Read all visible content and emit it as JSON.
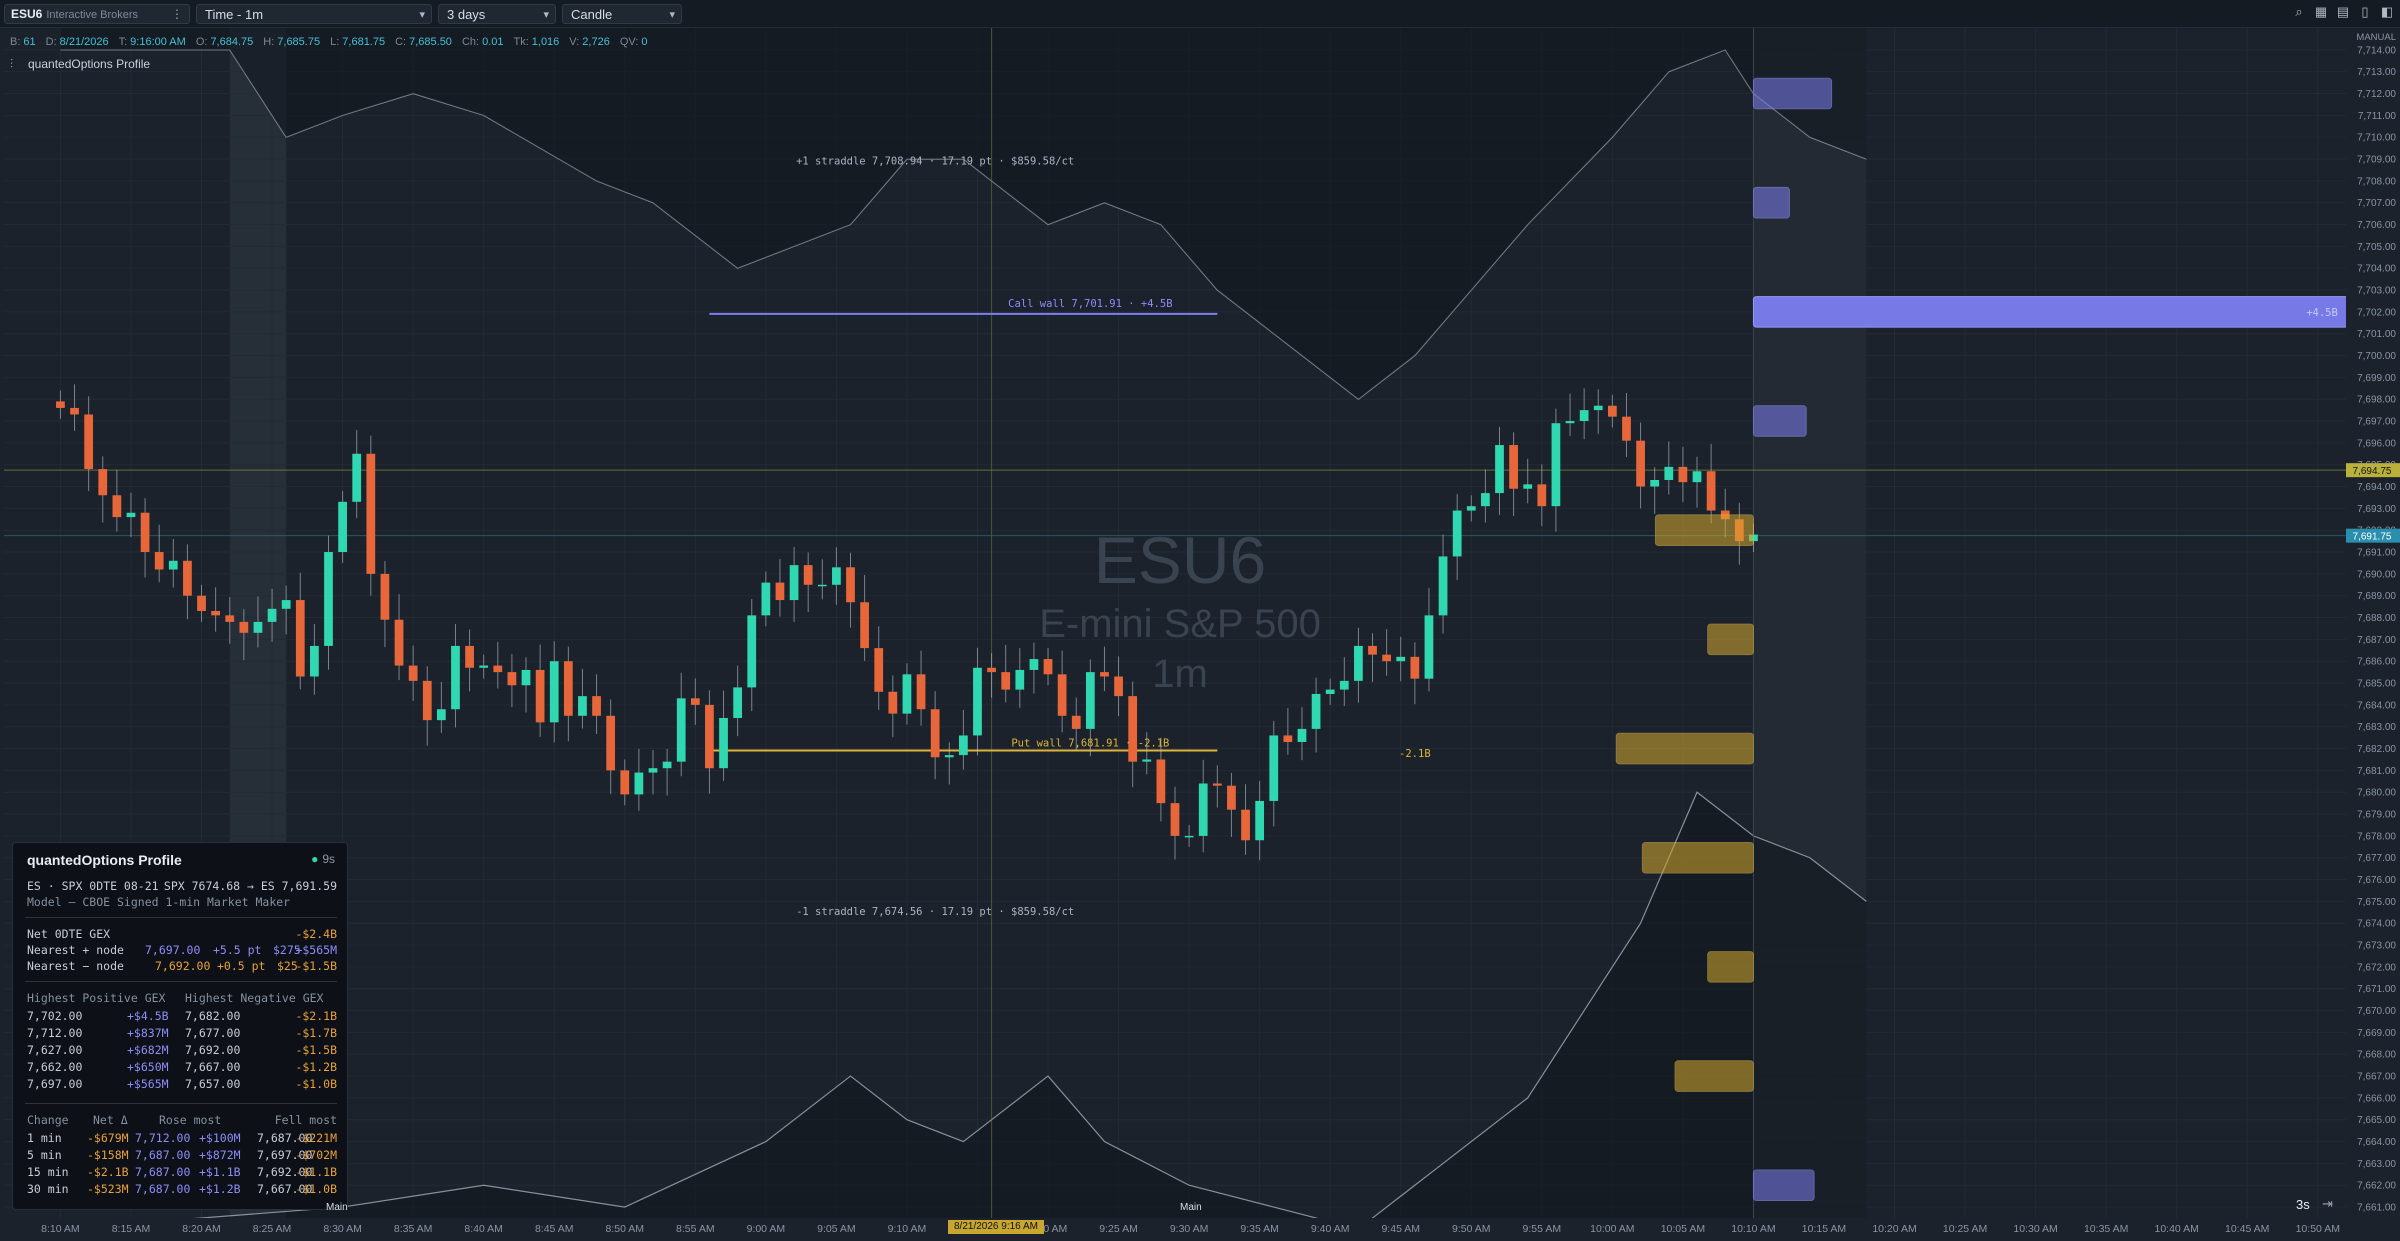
{
  "toolbar": {
    "symbol": "ESU6",
    "broker": "Interactive Brokers",
    "menu_glyph": "⋮",
    "timeframe": "Time - 1m",
    "range": "3 days",
    "style": "Candle",
    "icons": [
      "search-icon",
      "layout-icon",
      "layers-icon",
      "lock-icon",
      "panel-icon"
    ]
  },
  "ohlc": [
    {
      "k": "B:",
      "v": "61"
    },
    {
      "k": "D:",
      "v": "8/21/2026"
    },
    {
      "k": "T:",
      "v": "9:16:00 AM"
    },
    {
      "k": "O:",
      "v": "7,684.75"
    },
    {
      "k": "H:",
      "v": "7,685.75"
    },
    {
      "k": "L:",
      "v": "7,681.75"
    },
    {
      "k": "C:",
      "v": "7,685.50"
    },
    {
      "k": "Ch:",
      "v": "0.01"
    },
    {
      "k": "Tk:",
      "v": "1,016"
    },
    {
      "k": "V:",
      "v": "2,726"
    },
    {
      "k": "QV:",
      "v": "0"
    }
  ],
  "indicator_label": "quantedOptions Profile",
  "watermark": {
    "symbol": "ESU6",
    "name": "E-mini S&P 500",
    "tf": "1m"
  },
  "axis_mode": "MANUAL",
  "price_badges": {
    "last": "7,694.75",
    "current": "7,691.75"
  },
  "date_badge": "8/21/2026 9:16 AM",
  "main_tag": "Main",
  "status_right": "3s",
  "annotations": {
    "plus_straddle": "+1 straddle 7,708.94 · 17.19 pt · $859.58/ct",
    "minus_straddle": "-1 straddle 7,674.56 · 17.19 pt · $859.58/ct",
    "call_wall": "Call wall 7,701.91 · +4.5B",
    "put_wall": "Put wall 7,681.91 · -2.1B",
    "put_wall_short": "-2.1B",
    "call_wall_short": "+4.5B"
  },
  "panel": {
    "title": "quantedOptions Profile",
    "age": "9s",
    "line1_left": "ES · SPX 0DTE 08-21",
    "line1_right": "SPX 7674.68 → ES 7,691.59",
    "model": "Model — CBOE Signed 1-min Market Maker",
    "net_label": "Net 0DTE GEX",
    "net_value": "-$2.4B",
    "nearest_pos": {
      "label": "Nearest + node",
      "price": "7,697.00",
      "dist": "+5.5 pt",
      "strike": "$275",
      "gex": "+$565M"
    },
    "nearest_neg": {
      "label": "Nearest − node",
      "price": "7,692.00",
      "dist": "+0.5 pt",
      "strike": "$25",
      "gex": "-$1.5B"
    },
    "hp_header": "Highest Positive GEX",
    "hn_header": "Highest Negative GEX",
    "hp_rows": [
      {
        "p": "7,702.00",
        "v": "+$4.5B"
      },
      {
        "p": "7,712.00",
        "v": "+$837M"
      },
      {
        "p": "7,627.00",
        "v": "+$682M"
      },
      {
        "p": "7,662.00",
        "v": "+$650M"
      },
      {
        "p": "7,697.00",
        "v": "+$565M"
      }
    ],
    "hn_rows": [
      {
        "p": "7,682.00",
        "v": "-$2.1B"
      },
      {
        "p": "7,677.00",
        "v": "-$1.7B"
      },
      {
        "p": "7,692.00",
        "v": "-$1.5B"
      },
      {
        "p": "7,667.00",
        "v": "-$1.2B"
      },
      {
        "p": "7,657.00",
        "v": "-$1.0B"
      }
    ],
    "chg_headers": [
      "Change",
      "Net Δ",
      "Rose most",
      "Fell most"
    ],
    "chg_rows": [
      {
        "t": "1 min",
        "net": "-$679M",
        "rp": "7,712.00",
        "rv": "+$100M",
        "fp": "7,687.00",
        "fv": "-$221M"
      },
      {
        "t": "5 min",
        "net": "-$158M",
        "rp": "7,687.00",
        "rv": "+$872M",
        "fp": "7,697.00",
        "fv": "-$702M"
      },
      {
        "t": "15 min",
        "net": "-$2.1B",
        "rp": "7,687.00",
        "rv": "+$1.1B",
        "fp": "7,692.00",
        "fv": "-$1.1B"
      },
      {
        "t": "30 min",
        "net": "-$523M",
        "rp": "7,687.00",
        "rv": "+$1.2B",
        "fp": "7,667.00",
        "fv": "-$1.0B"
      }
    ]
  },
  "colors": {
    "up": "#2fd8b0",
    "down": "#e8673a",
    "pos_gex": "#7c7ff0",
    "neg_gex": "#d7a92e",
    "profile": "#a4adb8",
    "call_wall": "#7c7ff0",
    "put_wall": "#e0b437"
  },
  "chart_data": {
    "type": "candlestick",
    "ylim": [
      7660.5,
      7715
    ],
    "y_ticks": [
      "7,714.00",
      "7,713.00",
      "7,712.00",
      "7,711.00",
      "7,710.00",
      "7,709.00",
      "7,708.00",
      "7,707.00",
      "7,706.00",
      "7,705.00",
      "7,704.00",
      "7,703.00",
      "7,702.00",
      "7,701.00",
      "7,700.00",
      "7,699.00",
      "7,698.00",
      "7,697.00",
      "7,696.00",
      "7,695.00",
      "7,694.00",
      "7,693.00",
      "7,692.00",
      "7,691.00",
      "7,690.00",
      "7,689.00",
      "7,688.00",
      "7,687.00",
      "7,686.00",
      "7,685.00",
      "7,684.00",
      "7,683.00",
      "7,682.00",
      "7,681.00",
      "7,680.00",
      "7,679.00",
      "7,678.00",
      "7,677.00",
      "7,676.00",
      "7,675.00",
      "7,674.00",
      "7,673.00",
      "7,672.00",
      "7,671.00",
      "7,670.00",
      "7,669.00",
      "7,668.00",
      "7,667.00",
      "7,666.00",
      "7,665.00",
      "7,664.00",
      "7,663.00",
      "7,662.00",
      "7,661.00"
    ],
    "x_ticks": [
      "8:10 AM",
      "8:15 AM",
      "8:20 AM",
      "8:25 AM",
      "8:30 AM",
      "8:35 AM",
      "8:40 AM",
      "8:45 AM",
      "8:50 AM",
      "8:55 AM",
      "9:00 AM",
      "9:05 AM",
      "9:10 AM",
      "9:15 AM",
      "9:20 AM",
      "9:25 AM",
      "9:30 AM",
      "9:35 AM",
      "9:40 AM",
      "9:45 AM",
      "9:50 AM",
      "9:55 AM",
      "10:00 AM",
      "10:05 AM",
      "10:10 AM",
      "10:15 AM",
      "10:20 AM",
      "10:25 AM",
      "10:30 AM",
      "10:35 AM",
      "10:40 AM",
      "10:45 AM",
      "10:50 AM"
    ],
    "x_tick_minutes": [
      0,
      5,
      10,
      15,
      20,
      25,
      30,
      35,
      40,
      45,
      50,
      55,
      60,
      65,
      70,
      75,
      80,
      85,
      90,
      95,
      100,
      105,
      110,
      115,
      120,
      125,
      130,
      135,
      140,
      145,
      150,
      155,
      160
    ],
    "x_range_minutes": [
      -4,
      162
    ],
    "closes": [
      7697.6,
      7697.3,
      7694.8,
      7693.6,
      7692.6,
      7692.8,
      7691.0,
      7690.2,
      7690.6,
      7689.0,
      7688.3,
      7688.1,
      7687.8,
      7687.3,
      7687.8,
      7688.4,
      7688.8,
      7685.3,
      7686.7,
      7691.0,
      7693.3,
      7695.5,
      7690.0,
      7687.9,
      7685.8,
      7685.1,
      7683.3,
      7683.8,
      7686.7,
      7685.7,
      7685.8,
      7685.5,
      7684.9,
      7685.6,
      7683.2,
      7686.0,
      7683.5,
      7684.4,
      7683.5,
      7681.0,
      7679.9,
      7680.9,
      7681.1,
      7681.4,
      7684.3,
      7684.0,
      7681.1,
      7683.4,
      7684.8,
      7688.1,
      7689.6,
      7688.8,
      7690.4,
      7689.5,
      7689.5,
      7690.3,
      7688.7,
      7686.6,
      7684.6,
      7683.6,
      7685.4,
      7683.8,
      7681.6,
      7681.7,
      7682.6,
      7685.7,
      7685.5,
      7684.7,
      7685.6,
      7686.1,
      7685.4,
      7683.5,
      7682.9,
      7685.5,
      7685.3,
      7684.4,
      7681.4,
      7681.5,
      7679.5,
      7678.0,
      7678.0,
      7680.4,
      7680.3,
      7679.2,
      7677.8,
      7679.6,
      7682.6,
      7682.3,
      7682.9,
      7684.5,
      7684.7,
      7685.1,
      7686.7,
      7686.3,
      7686.0,
      7686.2,
      7685.2,
      7688.1,
      7690.8,
      7692.9,
      7693.1,
      7693.7,
      7695.9,
      7693.9,
      7694.1,
      7693.1,
      7696.9,
      7697.0,
      7697.5,
      7697.7,
      7697.2,
      7696.1,
      7694.0,
      7694.3,
      7694.9,
      7694.2,
      7694.7,
      7692.9,
      7692.5,
      7691.5,
      7691.8
    ],
    "profile_gex_bars": [
      {
        "price": 7712,
        "gex_m": 837
      },
      {
        "price": 7707,
        "gex_m": 300
      },
      {
        "price": 7702,
        "gex_m": 4500
      },
      {
        "price": 7697,
        "gex_m": 565
      },
      {
        "price": 7692,
        "gex_m": -1500
      },
      {
        "price": 7687,
        "gex_m": -700
      },
      {
        "price": 7682,
        "gex_m": -2100
      },
      {
        "price": 7677,
        "gex_m": -1700
      },
      {
        "price": 7672,
        "gex_m": -700
      },
      {
        "price": 7667,
        "gex_m": -1200
      },
      {
        "price": 7662,
        "gex_m": 650
      }
    ],
    "levels": {
      "call_wall": 7701.91,
      "put_wall": 7681.91,
      "plus_straddle": 7708.94,
      "minus_straddle": 7674.56,
      "hline_last": 7694.75,
      "hline_current": 7691.75
    }
  }
}
